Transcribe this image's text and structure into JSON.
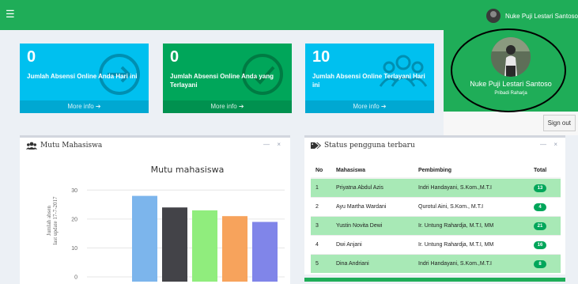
{
  "topbar": {
    "menu_icon": "hamburger-icon",
    "user_name": "Nuke Puji Lestari Santoso"
  },
  "info_boxes": [
    {
      "number": "0",
      "label": "Jumlah Absensi Online Anda Hari ini",
      "more": "More info ➔",
      "icon": "arrow-circle-icon",
      "color": "#00c0ef"
    },
    {
      "number": "0",
      "label": "Jumlah Absensi Online Anda yang Terlayani",
      "more": "More info ➔",
      "icon": "check-circle-icon",
      "color": "#00a65a"
    },
    {
      "number": "10",
      "label": "Jumlah Absensi Online Terlayani Hari ini",
      "more": "More info ➔",
      "icon": "users-icon",
      "color": "#00c0ef"
    }
  ],
  "profile": {
    "name": "Nuke Puji Lestari Santoso",
    "role": "Pribadi Raharja",
    "sign_out": "Sign out"
  },
  "panel_mutu": {
    "title": "Mutu Mahasiswa",
    "minimize": "—",
    "close": "×"
  },
  "panel_status": {
    "title": "Status pengguna terbaru",
    "minimize": "—",
    "close": "×",
    "columns": [
      "No",
      "Mahasiswa",
      "Pembimbing",
      "Total"
    ],
    "rows": [
      {
        "no": "1",
        "mahasiswa": "Priyatna Abdul Azis",
        "pembimbing": "Indri Handayani, S.Kom.,M.T.I",
        "total": "13"
      },
      {
        "no": "2",
        "mahasiswa": "Ayu Martha Wardani",
        "pembimbing": "Qurotul Aini, S.Kom., M.T.I",
        "total": "4"
      },
      {
        "no": "3",
        "mahasiswa": "Yustin Novita Dewi",
        "pembimbing": "Ir. Untung Rahardja, M.T.I, MM",
        "total": "21"
      },
      {
        "no": "4",
        "mahasiswa": "Dwi Anjani",
        "pembimbing": "Ir. Untung Rahardja, M.T.I, MM",
        "total": "16"
      },
      {
        "no": "5",
        "mahasiswa": "Dina Andriani",
        "pembimbing": "Indri Handayani, S.Kom.,M.T.I",
        "total": "8"
      }
    ]
  },
  "chart_data": {
    "type": "bar",
    "title": "Mutu mahasiswa",
    "ylabel": "Jumlah absen",
    "ylabel2": "last update 17-7-2017",
    "ylim": [
      0,
      35
    ],
    "yticks": [
      0,
      10,
      20,
      30
    ],
    "grid": true,
    "values": [
      28,
      24,
      23,
      21,
      19
    ],
    "colors": [
      "#7cb5ec",
      "#434348",
      "#90ed7d",
      "#f7a35c",
      "#8085e9"
    ]
  }
}
